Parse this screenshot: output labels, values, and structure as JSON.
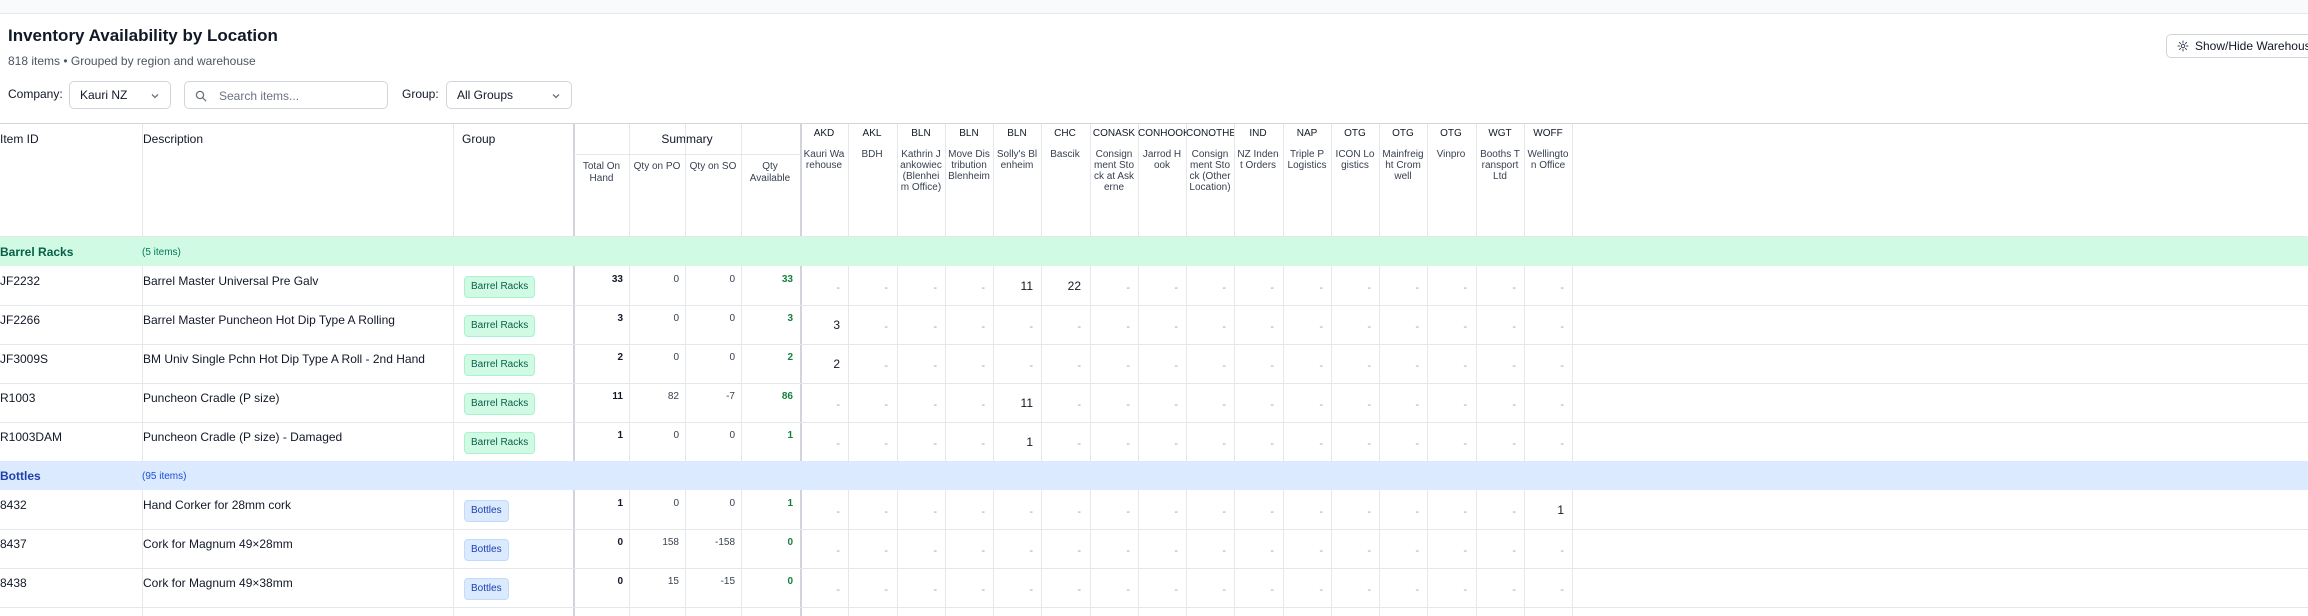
{
  "page": {
    "title": "Inventory Availability by Location",
    "subtitle": "818 items • Grouped by region and warehouse",
    "toggle_label": "Show/Hide Warehouses",
    "toggle_icon": "gear-icon"
  },
  "filters": {
    "company_label": "Company:",
    "company_value": "Kauri NZ",
    "search_placeholder": "Search items...",
    "search_value": "",
    "group_label": "Group:",
    "group_value": "All Groups"
  },
  "table": {
    "headers": {
      "item_id": "Item ID",
      "description": "Description",
      "group": "Group",
      "summary": "Summary"
    },
    "summary_columns": [
      "Total On Hand",
      "Qty on PO",
      "Qty on SO",
      "Qty Available"
    ],
    "warehouses": [
      {
        "code": "AKD",
        "name": "Kauri Warehouse"
      },
      {
        "code": "AKL",
        "name": "BDH"
      },
      {
        "code": "BLN",
        "name": "Kathrin Jankowiec (Blenheim Office)"
      },
      {
        "code": "BLN",
        "name": "Move Distribution Blenheim"
      },
      {
        "code": "BLN",
        "name": "Solly's Blenheim"
      },
      {
        "code": "CHC",
        "name": "Bascik"
      },
      {
        "code": "CONASK",
        "name": "Consignment Stock at Askerne"
      },
      {
        "code": "CONHOOK",
        "name": "Jarrod Hook"
      },
      {
        "code": "CONOTHER",
        "name": "Consignment Stock (Other Location)"
      },
      {
        "code": "IND",
        "name": "NZ Indent Orders"
      },
      {
        "code": "NAP",
        "name": "Triple P Logistics"
      },
      {
        "code": "OTG",
        "name": "ICON Logistics"
      },
      {
        "code": "OTG",
        "name": "Mainfreight Cromwell"
      },
      {
        "code": "OTG",
        "name": "Vinpro"
      },
      {
        "code": "WGT",
        "name": "Booths Transport Ltd"
      },
      {
        "code": "WOFF",
        "name": "Wellington Office"
      }
    ],
    "groups": [
      {
        "name": "Barrel Racks",
        "count_label": "(5 items)",
        "color": "#d1fae5",
        "items": [
          {
            "id": "JF2232",
            "description": "Barrel Master Universal Pre Galv",
            "group": "Barrel Racks",
            "total_on_hand": "33",
            "qty_on_po": "0",
            "qty_on_so": "0",
            "qty_available": "33",
            "warehouses": [
              "-",
              "-",
              "-",
              "-",
              "11",
              "22",
              "-",
              "-",
              "-",
              "-",
              "-",
              "-",
              "-",
              "-",
              "-",
              "-"
            ]
          },
          {
            "id": "JF2266",
            "description": "Barrel Master Puncheon Hot Dip Type A Rolling",
            "group": "Barrel Racks",
            "total_on_hand": "3",
            "qty_on_po": "0",
            "qty_on_so": "0",
            "qty_available": "3",
            "warehouses": [
              "3",
              "-",
              "-",
              "-",
              "-",
              "-",
              "-",
              "-",
              "-",
              "-",
              "-",
              "-",
              "-",
              "-",
              "-",
              "-"
            ]
          },
          {
            "id": "JF3009S",
            "description": "BM Univ Single Pchn Hot Dip Type A Roll - 2nd Hand",
            "group": "Barrel Racks",
            "total_on_hand": "2",
            "qty_on_po": "0",
            "qty_on_so": "0",
            "qty_available": "2",
            "warehouses": [
              "2",
              "-",
              "-",
              "-",
              "-",
              "-",
              "-",
              "-",
              "-",
              "-",
              "-",
              "-",
              "-",
              "-",
              "-",
              "-"
            ]
          },
          {
            "id": "R1003",
            "description": "Puncheon Cradle (P size)",
            "group": "Barrel Racks",
            "total_on_hand": "11",
            "qty_on_po": "82",
            "qty_on_so": "-7",
            "qty_available": "86",
            "warehouses": [
              "-",
              "-",
              "-",
              "-",
              "11",
              "-",
              "-",
              "-",
              "-",
              "-",
              "-",
              "-",
              "-",
              "-",
              "-",
              "-"
            ]
          },
          {
            "id": "R1003DAM",
            "description": "Puncheon Cradle (P size) - Damaged",
            "group": "Barrel Racks",
            "total_on_hand": "1",
            "qty_on_po": "0",
            "qty_on_so": "0",
            "qty_available": "1",
            "warehouses": [
              "-",
              "-",
              "-",
              "-",
              "1",
              "-",
              "-",
              "-",
              "-",
              "-",
              "-",
              "-",
              "-",
              "-",
              "-",
              "-"
            ]
          }
        ]
      },
      {
        "name": "Bottles",
        "count_label": "(95 items)",
        "color": "#dbeafe",
        "items": [
          {
            "id": "8432",
            "description": "Hand Corker for 28mm cork",
            "group": "Bottles",
            "total_on_hand": "1",
            "qty_on_po": "0",
            "qty_on_so": "0",
            "qty_available": "1",
            "warehouses": [
              "-",
              "-",
              "-",
              "-",
              "-",
              "-",
              "-",
              "-",
              "-",
              "-",
              "-",
              "-",
              "-",
              "-",
              "-",
              "1"
            ]
          },
          {
            "id": "8437",
            "description": "Cork for Magnum 49×28mm",
            "group": "Bottles",
            "total_on_hand": "0",
            "qty_on_po": "158",
            "qty_on_so": "-158",
            "qty_available": "0",
            "warehouses": [
              "-",
              "-",
              "-",
              "-",
              "-",
              "-",
              "-",
              "-",
              "-",
              "-",
              "-",
              "-",
              "-",
              "-",
              "-",
              "-"
            ]
          },
          {
            "id": "8438",
            "description": "Cork for Magnum 49×38mm",
            "group": "Bottles",
            "total_on_hand": "0",
            "qty_on_po": "15",
            "qty_on_so": "-15",
            "qty_available": "0",
            "warehouses": [
              "-",
              "-",
              "-",
              "-",
              "-",
              "-",
              "-",
              "-",
              "-",
              "-",
              "-",
              "-",
              "-",
              "-",
              "-",
              "-"
            ]
          }
        ]
      }
    ]
  }
}
